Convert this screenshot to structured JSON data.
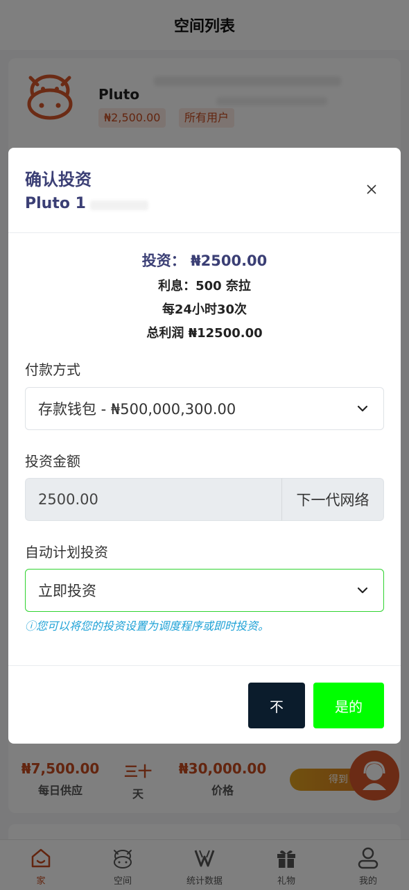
{
  "header": {
    "title": "空间列表"
  },
  "plan_card": {
    "name": "Pluto",
    "price": "₦2,500.00",
    "audience": "所有用户"
  },
  "plan_stats": {
    "daily_value": "₦7,500.00",
    "daily_label": "每日供应",
    "days_value": "三十",
    "days_label": "天",
    "price_value": "₦30,000.00",
    "price_label": "价格",
    "get_label": "得到"
  },
  "bottom_nav": {
    "items": [
      {
        "label": "家",
        "icon": "home-icon"
      },
      {
        "label": "空间",
        "icon": "cow-icon"
      },
      {
        "label": "统计数据",
        "icon": "stats-icon"
      },
      {
        "label": "礼物",
        "icon": "gift-icon"
      },
      {
        "label": "我的",
        "icon": "user-icon"
      }
    ]
  },
  "modal": {
    "title": "确认投资",
    "subtitle": "Pluto 1",
    "summary": {
      "investment": "投资：  ₦2500.00",
      "interest": "利息：500 奈拉",
      "frequency": "每24小时30次",
      "total_profit": "总利润 ₦12500.00"
    },
    "payment_label": "付款方式",
    "payment_selected": "存款钱包 - ₦500,000,300.00",
    "amount_label": "投资金额",
    "amount_value": "2500.00",
    "amount_addon": "下一代网络",
    "schedule_label": "自动计划投资",
    "schedule_selected": "立即投资",
    "hint": "ⓘ您可以将您的投资设置为调度程序或即时投资。",
    "no_label": "不",
    "yes_label": "是的"
  },
  "colors": {
    "accent": "#c64a1e",
    "title": "#3b3f75",
    "yes_button": "#00ff00",
    "no_button": "#0b1c2c",
    "hint": "#1da1d6"
  }
}
